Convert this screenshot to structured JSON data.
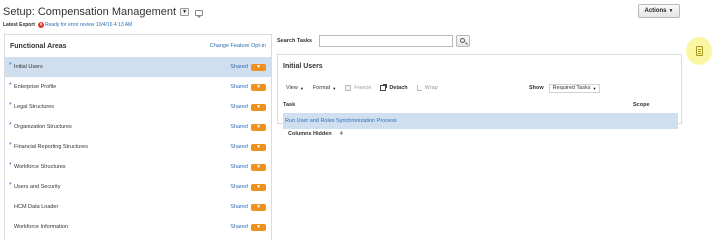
{
  "header": {
    "title": "Setup: Compensation Management",
    "title_dropdown_icon": "chevron-down",
    "latest_export_label": "Latest Export",
    "export_status": "Ready for error review 10/4/16 4:13 AM",
    "actions_label": "Actions"
  },
  "functional_areas": {
    "title": "Functional Areas",
    "change_link": "Change Feature Opt-in",
    "items": [
      {
        "label": "Initial Users",
        "status": "Shared",
        "required": true,
        "selected": true
      },
      {
        "label": "Enterprise Profile",
        "status": "Shared",
        "required": true
      },
      {
        "label": "Legal Structures",
        "status": "Shared",
        "required": true
      },
      {
        "label": "Organization Structures",
        "status": "Shared",
        "required": true
      },
      {
        "label": "Financial Reporting Structures",
        "status": "Shared",
        "required": true
      },
      {
        "label": "Workforce Structures",
        "status": "Shared",
        "required": true
      },
      {
        "label": "Users and Security",
        "status": "Shared",
        "required": true
      },
      {
        "label": "HCM Data Loader",
        "status": "Shared",
        "required": false
      },
      {
        "label": "Workforce Information",
        "status": "Shared",
        "required": false
      }
    ]
  },
  "search": {
    "label": "Search Tasks",
    "value": "",
    "placeholder": ""
  },
  "task_panel": {
    "title": "Initial Users",
    "toolbar": {
      "view": "View",
      "format": "Format",
      "freeze": "Freeze",
      "detach": "Detach",
      "wrap": "Wrap",
      "show_label": "Show",
      "show_value": "Required Tasks"
    },
    "columns": {
      "task": "Task",
      "scope": "Scope"
    },
    "rows": [
      {
        "task": "Run User and Roles Synchronization Process",
        "scope": ""
      }
    ],
    "columns_hidden_label": "Columns Hidden",
    "columns_hidden_count": "4"
  },
  "colors": {
    "accent_orange": "#f0901f",
    "link_blue": "#2f6eb5",
    "selected_row": "#cfdff0",
    "error_red": "#d9332c",
    "note_yellow": "#fbf6a4"
  }
}
